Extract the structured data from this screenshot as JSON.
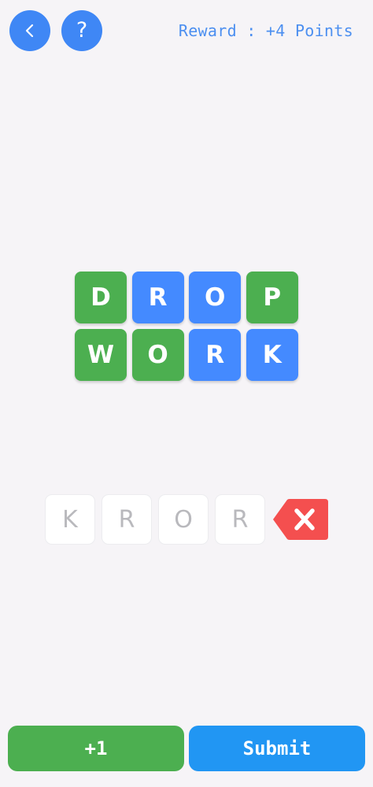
{
  "header": {
    "back_icon": "chevron-left-icon",
    "help_label": "?",
    "reward_text": "Reward : +4 Points"
  },
  "colors": {
    "background": "#f6f4f7",
    "accent_blue": "#3f87f5",
    "tile_green": "#4caf50",
    "tile_blue": "#448aff",
    "delete_red": "#f44f4f",
    "submit_blue": "#2196f3"
  },
  "tiles": [
    {
      "letter": "D",
      "color": "green"
    },
    {
      "letter": "R",
      "color": "blue"
    },
    {
      "letter": "O",
      "color": "blue"
    },
    {
      "letter": "P",
      "color": "green"
    },
    {
      "letter": "W",
      "color": "green"
    },
    {
      "letter": "O",
      "color": "green"
    },
    {
      "letter": "R",
      "color": "blue"
    },
    {
      "letter": "K",
      "color": "blue"
    }
  ],
  "answer": {
    "slots": [
      "K",
      "R",
      "O",
      "R"
    ],
    "delete_icon": "backspace-icon"
  },
  "footer": {
    "hint_label": "+1",
    "submit_label": "Submit"
  }
}
